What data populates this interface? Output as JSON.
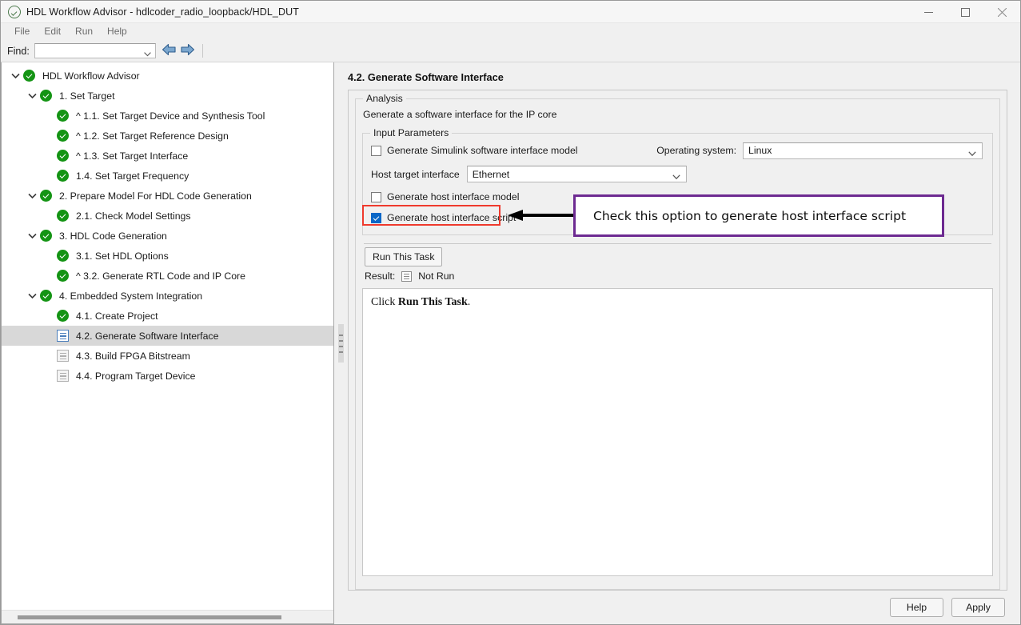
{
  "window": {
    "title": "HDL Workflow Advisor - hdlcoder_radio_loopback/HDL_DUT",
    "app_icon": "check-circle-icon",
    "minimize": "minimize-icon",
    "maximize": "maximize-icon",
    "close": "close-icon"
  },
  "menubar": {
    "items": [
      {
        "label": "File"
      },
      {
        "label": "Edit"
      },
      {
        "label": "Run"
      },
      {
        "label": "Help"
      }
    ]
  },
  "findbar": {
    "label": "Find:",
    "value": "",
    "placeholder": "",
    "prev_icon": "arrow-left-icon",
    "next_icon": "arrow-right-icon"
  },
  "tree": {
    "items": [
      {
        "label": "HDL Workflow Advisor",
        "indent": 0,
        "twisty": "expanded",
        "icon": "status-pass",
        "selected": false
      },
      {
        "label": "1. Set Target",
        "indent": 1,
        "twisty": "expanded",
        "icon": "status-pass",
        "selected": false
      },
      {
        "label": "^ 1.1. Set Target Device and Synthesis Tool",
        "indent": 2,
        "twisty": "none",
        "icon": "status-pass",
        "selected": false
      },
      {
        "label": "^ 1.2. Set Target Reference Design",
        "indent": 2,
        "twisty": "none",
        "icon": "status-pass",
        "selected": false
      },
      {
        "label": "^ 1.3. Set Target Interface",
        "indent": 2,
        "twisty": "none",
        "icon": "status-pass",
        "selected": false
      },
      {
        "label": "1.4. Set Target Frequency",
        "indent": 2,
        "twisty": "none",
        "icon": "status-pass",
        "selected": false
      },
      {
        "label": "2. Prepare Model For HDL Code Generation",
        "indent": 1,
        "twisty": "expanded",
        "icon": "status-pass",
        "selected": false
      },
      {
        "label": "2.1. Check Model Settings",
        "indent": 2,
        "twisty": "none",
        "icon": "status-pass",
        "selected": false
      },
      {
        "label": "3. HDL Code Generation",
        "indent": 1,
        "twisty": "expanded",
        "icon": "status-pass",
        "selected": false
      },
      {
        "label": "3.1. Set HDL Options",
        "indent": 2,
        "twisty": "none",
        "icon": "status-pass",
        "selected": false
      },
      {
        "label": "^ 3.2. Generate RTL Code and IP Core",
        "indent": 2,
        "twisty": "none",
        "icon": "status-pass",
        "selected": false
      },
      {
        "label": "4. Embedded System Integration",
        "indent": 1,
        "twisty": "expanded",
        "icon": "status-pass",
        "selected": false
      },
      {
        "label": "4.1. Create Project",
        "indent": 2,
        "twisty": "none",
        "icon": "status-pass",
        "selected": false
      },
      {
        "label": "4.2. Generate Software Interface",
        "indent": 2,
        "twisty": "none",
        "icon": "task-active",
        "selected": true
      },
      {
        "label": "4.3. Build FPGA Bitstream",
        "indent": 2,
        "twisty": "none",
        "icon": "task-idle",
        "selected": false
      },
      {
        "label": "4.4. Program Target Device",
        "indent": 2,
        "twisty": "none",
        "icon": "task-idle",
        "selected": false
      }
    ]
  },
  "content": {
    "title": "4.2. Generate Software Interface",
    "analysis_legend": "Analysis",
    "description": "Generate a software interface for the IP core",
    "input_legend": "Input Parameters",
    "checkbox_simulink": {
      "label": "Generate Simulink software interface model",
      "checked": false
    },
    "checkbox_host_model": {
      "label": "Generate host interface model",
      "checked": false
    },
    "checkbox_host_script": {
      "label": "Generate host interface script",
      "checked": true
    },
    "host_target_interface": {
      "label": "Host target interface",
      "value": "Ethernet"
    },
    "operating_system": {
      "label": "Operating system:",
      "value": "Linux"
    },
    "run_button": "Run This Task",
    "result_label": "Result:",
    "result_status": "Not Run",
    "result_icon": "result-doc-icon",
    "result_text_prefix": "Click ",
    "result_text_bold": "Run This Task",
    "result_text_suffix": "."
  },
  "footer": {
    "help": "Help",
    "apply": "Apply"
  },
  "annotations": {
    "callout_text": "Check this option to generate host interface script",
    "highlight_color": "#ef3a2d",
    "callout_border_color": "#6d2a91",
    "arrow_color": "#000000"
  }
}
